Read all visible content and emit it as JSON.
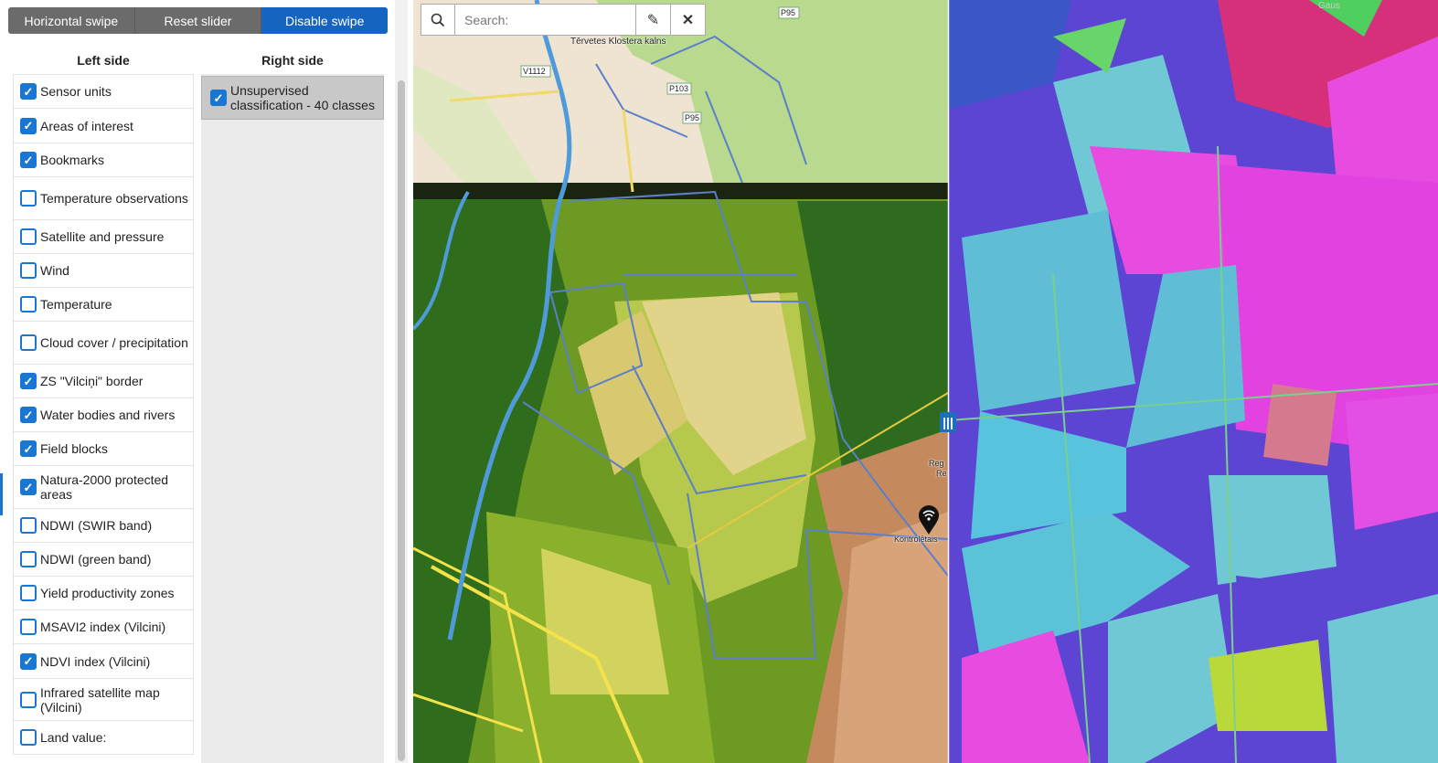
{
  "toolbar": {
    "horizontal_swipe": "Horizontal swipe",
    "reset_slider": "Reset slider",
    "disable_swipe": "Disable swipe"
  },
  "left_side": {
    "title": "Left side",
    "layers": [
      {
        "label": "Sensor units",
        "checked": true
      },
      {
        "label": "Areas of interest",
        "checked": true
      },
      {
        "label": "Bookmarks",
        "checked": true
      },
      {
        "label": "Temperature observations",
        "checked": false
      },
      {
        "label": "Satellite and pressure",
        "checked": false
      },
      {
        "label": "Wind",
        "checked": false
      },
      {
        "label": "Temperature",
        "checked": false
      },
      {
        "label": "Cloud cover / precipitation",
        "checked": false
      },
      {
        "label": "ZS \"Vilciņi\" border",
        "checked": true
      },
      {
        "label": "Water bodies and rivers",
        "checked": true
      },
      {
        "label": "Field blocks",
        "checked": true
      },
      {
        "label": "Natura-2000 protected areas",
        "checked": true
      },
      {
        "label": "NDWI (SWIR band)",
        "checked": false
      },
      {
        "label": "NDWI (green band)",
        "checked": false
      },
      {
        "label": "Yield productivity zones",
        "checked": false
      },
      {
        "label": "MSAVI2 index (Vilcini)",
        "checked": false
      },
      {
        "label": "NDVI index (Vilcini)",
        "checked": true
      },
      {
        "label": "Infrared satellite map (Vilcini)",
        "checked": false
      },
      {
        "label": "Land value:",
        "checked": false
      }
    ]
  },
  "right_side": {
    "title": "Right side",
    "layers": [
      {
        "label": "Unsupervised classification - 40 classes",
        "checked": true
      }
    ]
  },
  "map": {
    "search_placeholder": "Search:",
    "place_label": "Tērvetes Klostera kalns",
    "road_labels": [
      "V1112",
      "P103",
      "P95",
      "P95"
    ],
    "marker_label": "Kontrolētais",
    "side_label_1": "Reg",
    "side_label_2": "Re",
    "corner_label": "Gaus"
  },
  "icons": {
    "search": "search-icon",
    "edit": "pencil-icon",
    "clear": "close-icon",
    "swipe_handle": "grip-icon",
    "marker": "map-pin-icon",
    "checkbox": "checkmark-icon"
  },
  "colors": {
    "accent": "#1976d2",
    "toolbar_gray": "#6b6b6b",
    "toolbar_active": "#1565c0"
  }
}
